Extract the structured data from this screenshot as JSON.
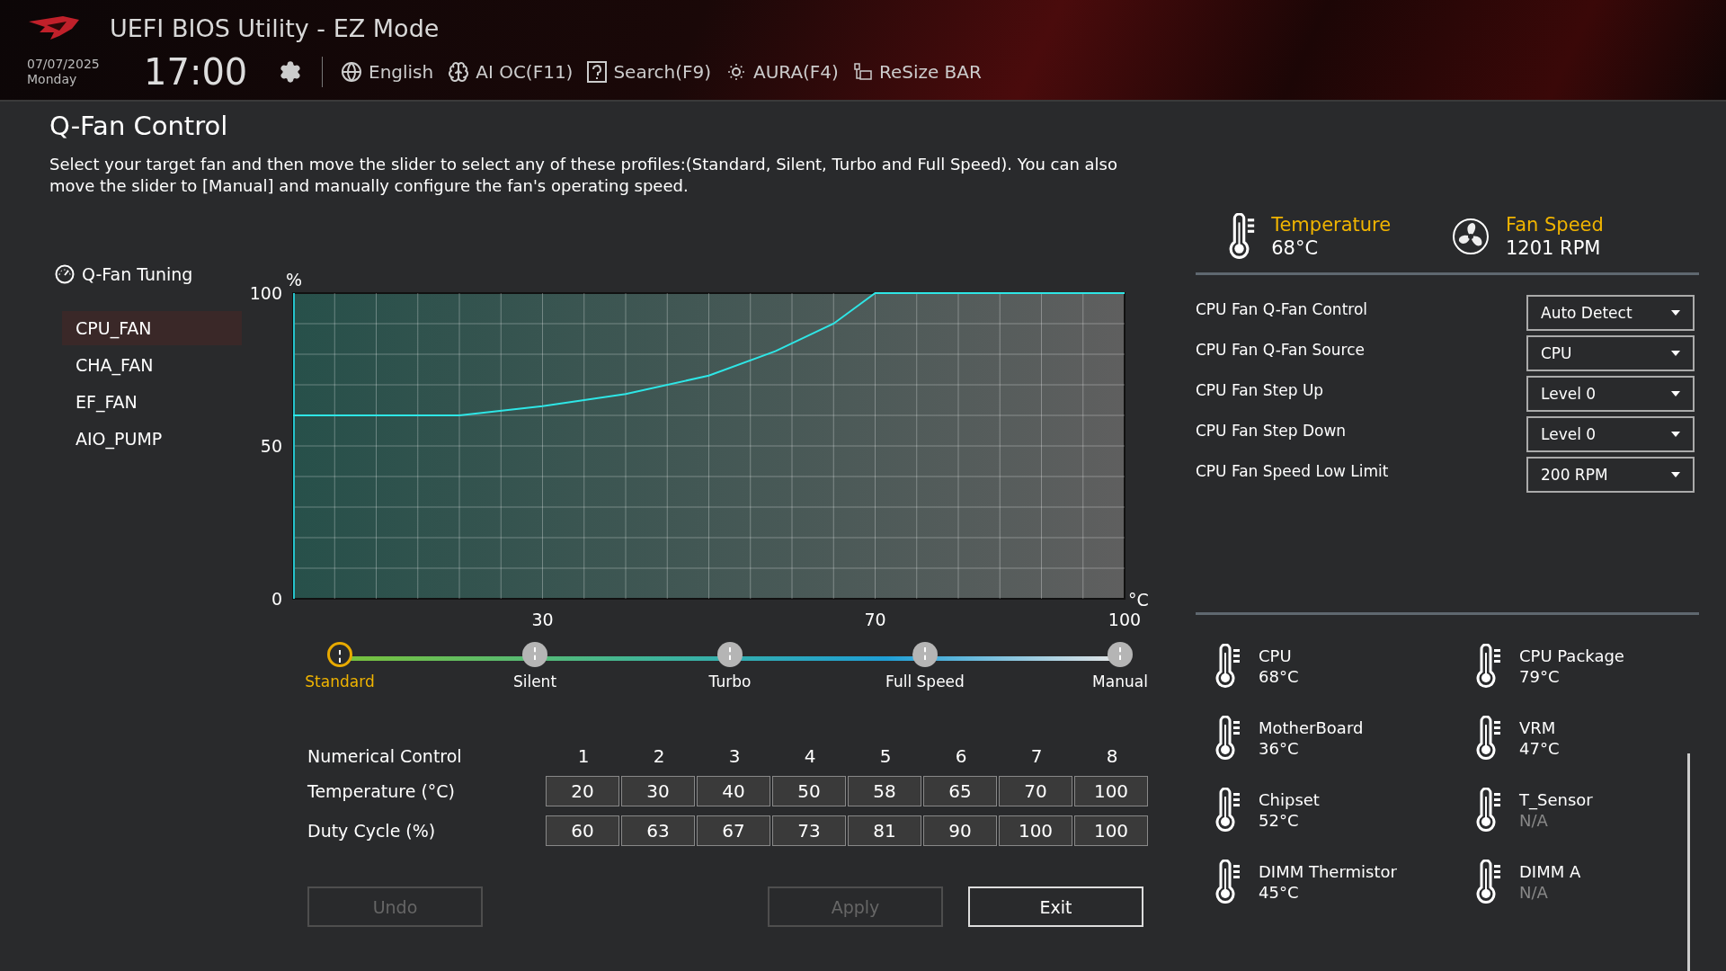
{
  "header": {
    "title": "UEFI BIOS Utility - EZ Mode",
    "date": "07/07/2025",
    "day": "Monday",
    "time": "17:00",
    "toolbar": [
      {
        "label": "English"
      },
      {
        "label": "AI OC(F11)"
      },
      {
        "label": "Search(F9)"
      },
      {
        "label": "AURA(F4)"
      },
      {
        "label": "ReSize BAR"
      }
    ]
  },
  "page": {
    "title": "Q-Fan Control",
    "description": "Select your target fan and then move the slider to select any of these profiles:(Standard, Silent, Turbo and Full Speed). You can also move the slider to [Manual] and manually configure the fan's operating speed."
  },
  "tuning": {
    "title": "Q-Fan Tuning",
    "fans": [
      {
        "label": "CPU_FAN",
        "selected": true
      },
      {
        "label": "CHA_FAN",
        "selected": false
      },
      {
        "label": "EF_FAN",
        "selected": false
      },
      {
        "label": "AIO_PUMP",
        "selected": false
      }
    ]
  },
  "fan_curve": {
    "chart_data": {
      "type": "line",
      "ylabel": "%",
      "xlabel": "°C",
      "x": [
        0,
        20,
        30,
        40,
        50,
        58,
        65,
        70,
        100
      ],
      "series": [
        {
          "color": "#2ee6e6",
          "values": [
            60,
            60,
            63,
            67,
            73,
            81,
            90,
            100,
            100
          ]
        }
      ],
      "xlim": [
        0,
        100
      ],
      "ylim": [
        0,
        100
      ],
      "grid": true,
      "xticks": [
        30,
        70,
        100
      ],
      "yticks": [
        0,
        50,
        100
      ]
    }
  },
  "profiles": [
    {
      "label": "Standard",
      "selected": true
    },
    {
      "label": "Silent",
      "selected": false
    },
    {
      "label": "Turbo",
      "selected": false
    },
    {
      "label": "Full Speed",
      "selected": false
    },
    {
      "label": "Manual",
      "selected": false
    }
  ],
  "numerical_control": {
    "label": "Numerical Control",
    "columns": [
      "1",
      "2",
      "3",
      "4",
      "5",
      "6",
      "7",
      "8"
    ],
    "rows": [
      {
        "label": "Temperature (°C)",
        "values": [
          "20",
          "30",
          "40",
          "50",
          "58",
          "65",
          "70",
          "100"
        ]
      },
      {
        "label": "Duty Cycle (%)",
        "values": [
          "60",
          "63",
          "67",
          "73",
          "81",
          "90",
          "100",
          "100"
        ]
      }
    ]
  },
  "buttons": [
    {
      "label": "Undo",
      "disabled": true
    },
    {
      "label": "Apply",
      "disabled": true
    },
    {
      "label": "Exit",
      "disabled": false
    }
  ],
  "status": [
    {
      "label": "Temperature",
      "value": "68°C"
    },
    {
      "label": "Fan Speed",
      "value": "1201 RPM"
    }
  ],
  "settings": [
    {
      "label": "CPU Fan Q-Fan Control",
      "value": "Auto Detect"
    },
    {
      "label": "CPU Fan Q-Fan Source",
      "value": "CPU"
    },
    {
      "label": "CPU Fan Step Up",
      "value": "Level 0"
    },
    {
      "label": "CPU Fan Step Down",
      "value": "Level 0"
    },
    {
      "label": "CPU Fan Speed Low Limit",
      "value": "200 RPM"
    }
  ],
  "sensors": [
    {
      "name": "CPU",
      "value": "68°C",
      "available": true
    },
    {
      "name": "CPU Package",
      "value": "79°C",
      "available": true
    },
    {
      "name": "MotherBoard",
      "value": "36°C",
      "available": true
    },
    {
      "name": "VRM",
      "value": "47°C",
      "available": true
    },
    {
      "name": "Chipset",
      "value": "52°C",
      "available": true
    },
    {
      "name": "T_Sensor",
      "value": "N/A",
      "available": false
    },
    {
      "name": "DIMM Thermistor",
      "value": "45°C",
      "available": true
    },
    {
      "name": "DIMM A",
      "value": "N/A",
      "available": false
    }
  ]
}
